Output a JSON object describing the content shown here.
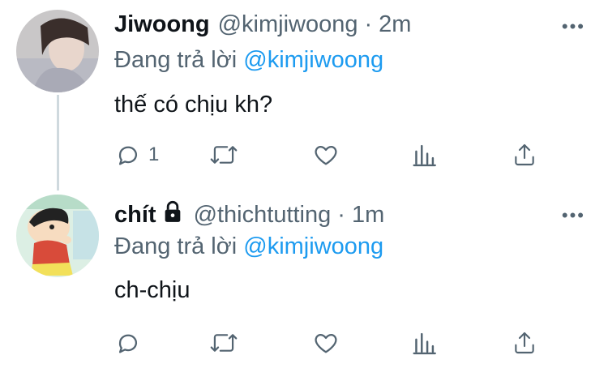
{
  "tweets": [
    {
      "name": "Jiwoong",
      "handle": "@kimjiwoong",
      "time": "2m",
      "replying_prefix": "Đang trả lời",
      "replying_to": "@kimjiwoong",
      "text": "thế có chịu kh?",
      "reply_count": "1",
      "locked": false
    },
    {
      "name": "chít",
      "handle": "@thichtutting",
      "time": "1m",
      "replying_prefix": "Đang trả lời",
      "replying_to": "@kimjiwoong",
      "text": "ch-chịu",
      "reply_count": "",
      "locked": true
    }
  ],
  "separator": "·",
  "more_label": "•••",
  "colors": {
    "link": "#1d9bf0",
    "muted": "#536471",
    "text": "#0f1419",
    "thread_line": "#cfd9de"
  },
  "icons": [
    "reply-icon",
    "retweet-icon",
    "like-icon",
    "analytics-icon",
    "share-icon",
    "lock-icon",
    "more-icon"
  ]
}
